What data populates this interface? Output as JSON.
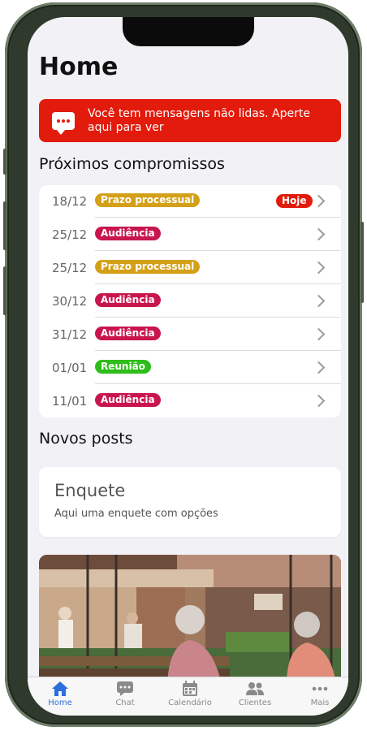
{
  "page": {
    "title": "Home"
  },
  "alert": {
    "text": "Você tem mensagens não lidas. Aperte aqui para ver",
    "icon": "chat-bubble-icon",
    "color": "#e21b0c"
  },
  "appointments": {
    "heading": "Próximos compromissos",
    "items": [
      {
        "date": "18/12",
        "tag": "Prazo processual",
        "tag_color": "#d4a017",
        "badge": "Hoje"
      },
      {
        "date": "25/12",
        "tag": "Audiência",
        "tag_color": "#c8164d"
      },
      {
        "date": "25/12",
        "tag": "Prazo processual",
        "tag_color": "#d4a017"
      },
      {
        "date": "30/12",
        "tag": "Audiência",
        "tag_color": "#c8164d"
      },
      {
        "date": "31/12",
        "tag": "Audiência",
        "tag_color": "#c8164d"
      },
      {
        "date": "01/01",
        "tag": "Reunião",
        "tag_color": "#2ebd1a"
      },
      {
        "date": "11/01",
        "tag": "Audiência",
        "tag_color": "#c8164d"
      }
    ]
  },
  "posts": {
    "heading": "Novos posts",
    "poll": {
      "title": "Enquete",
      "subtitle": "Aqui uma enquete com opções"
    }
  },
  "tabbar": {
    "active_color": "#2a6fdb",
    "tabs": [
      {
        "label": "Home",
        "icon": "home-icon"
      },
      {
        "label": "Chat",
        "icon": "chat-icon"
      },
      {
        "label": "Calendário",
        "icon": "calendar-icon"
      },
      {
        "label": "Clientes",
        "icon": "people-icon"
      },
      {
        "label": "Mais",
        "icon": "more-icon"
      }
    ]
  }
}
